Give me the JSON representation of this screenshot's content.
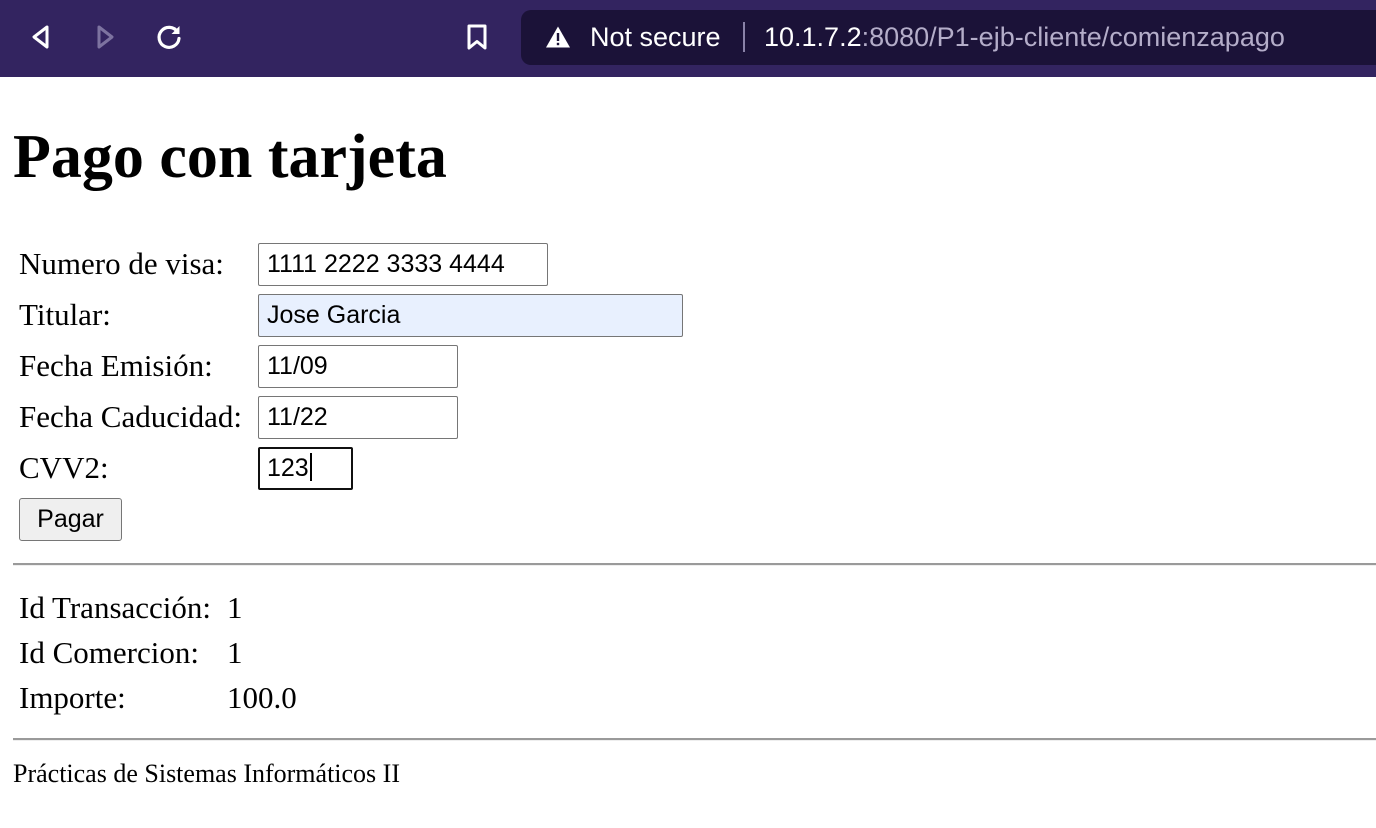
{
  "browser": {
    "security_label": "Not secure",
    "url_host": "10.1.7.2",
    "url_rest": ":8080/P1-ejb-cliente/comienzapago"
  },
  "page": {
    "title": "Pago con tarjeta"
  },
  "form": {
    "card_number_label": "Numero de visa:",
    "card_number_value": "1111 2222 3333 4444",
    "holder_label": "Titular:",
    "holder_value": "Jose Garcia",
    "issue_date_label": "Fecha Emisión:",
    "issue_date_value": "11/09",
    "expiry_date_label": "Fecha Caducidad:",
    "expiry_date_value": "11/22",
    "cvv_label": "CVV2:",
    "cvv_value": "123",
    "submit_label": "Pagar"
  },
  "transaction": {
    "id_label": "Id Transacción:",
    "id_value": "1",
    "merchant_label": "Id Comercion:",
    "merchant_value": "1",
    "amount_label": "Importe:",
    "amount_value": "100.0"
  },
  "footer": {
    "text": "Prácticas de Sistemas Informáticos II"
  },
  "icons": {
    "back": "back-arrow-icon",
    "forward": "forward-arrow-icon",
    "reload": "reload-icon",
    "bookmark": "bookmark-icon",
    "security": "warning-triangle-icon"
  },
  "colors": {
    "toolbar": "#332460",
    "urlbar": "#1b1238",
    "autofill": "#e8f0fe"
  }
}
